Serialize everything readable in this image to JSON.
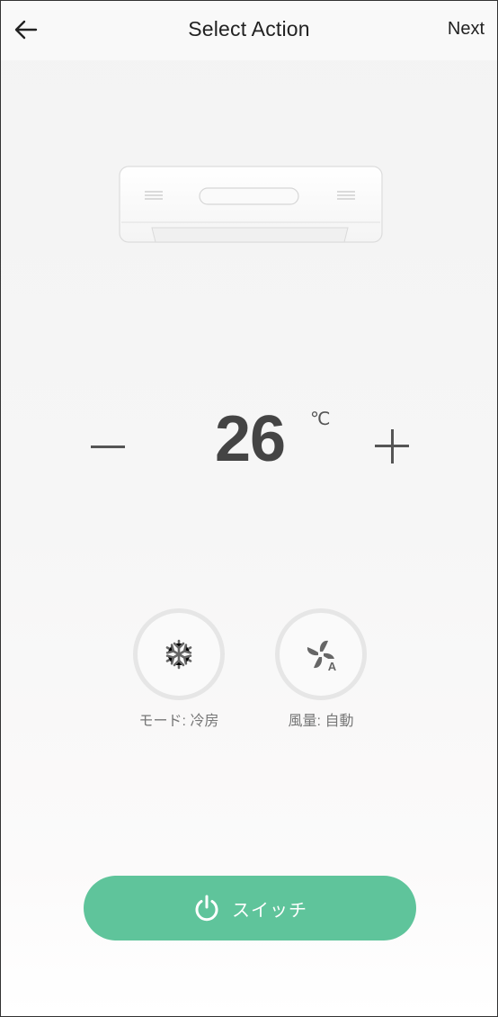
{
  "header": {
    "title": "Select Action",
    "next_label": "Next",
    "back_icon": "arrow-left-icon"
  },
  "device": {
    "icon": "air-conditioner-icon"
  },
  "temperature": {
    "value": "26",
    "unit": "℃",
    "decrease_icon": "minus-icon",
    "increase_icon": "plus-icon"
  },
  "controls": {
    "mode": {
      "icon": "snowflake-icon",
      "label": "モード: 冷房"
    },
    "fan": {
      "icon": "fan-auto-icon",
      "label": "風量: 自動"
    }
  },
  "switch": {
    "icon": "power-icon",
    "label": "スイッチ"
  },
  "colors": {
    "accent": "#5fc49b",
    "text": "#222222",
    "muted": "#777777"
  }
}
